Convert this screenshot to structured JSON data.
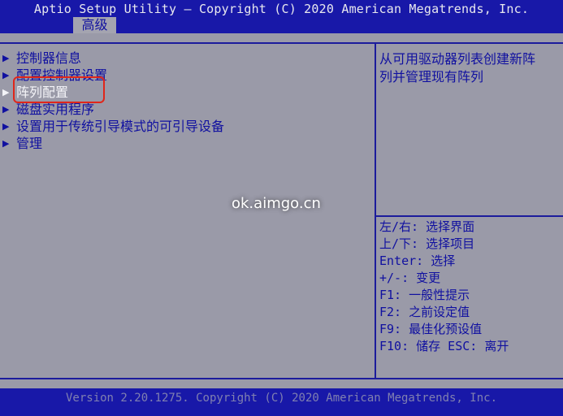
{
  "header": {
    "title": "Aptio Setup Utility – Copyright (C) 2020 American Megatrends, Inc.",
    "active_tab": "高级"
  },
  "menu": {
    "items": [
      {
        "label": "控制器信息"
      },
      {
        "label": "配置控制器设置"
      },
      {
        "label": "阵列配置"
      },
      {
        "label": "磁盘实用程序"
      },
      {
        "label": "设置用于传统引导模式的可引导设备"
      },
      {
        "label": "管理"
      }
    ],
    "selected_index": 2
  },
  "help": {
    "line1": "从可用驱动器列表创建新阵",
    "line2": "列并管理现有阵列"
  },
  "keys": [
    "左/右: 选择界面",
    "上/下: 选择项目",
    "Enter: 选择",
    "+/-: 变更",
    "F1: 一般性提示",
    "F2: 之前设定值",
    "F9: 最佳化预设值",
    "F10: 储存  ESC: 离开"
  ],
  "watermark": "ok.aimgo.cn",
  "footer": "Version 2.20.1275. Copyright (C) 2020 American Megatrends, Inc.",
  "colors": {
    "bar": "#1818a8",
    "background": "#9a9aa8",
    "text": "#1010a0",
    "selected": "#f4f4f8",
    "highlight_box": "#e0261a"
  },
  "icons": {
    "menu_arrow": "triangle-right-icon"
  }
}
